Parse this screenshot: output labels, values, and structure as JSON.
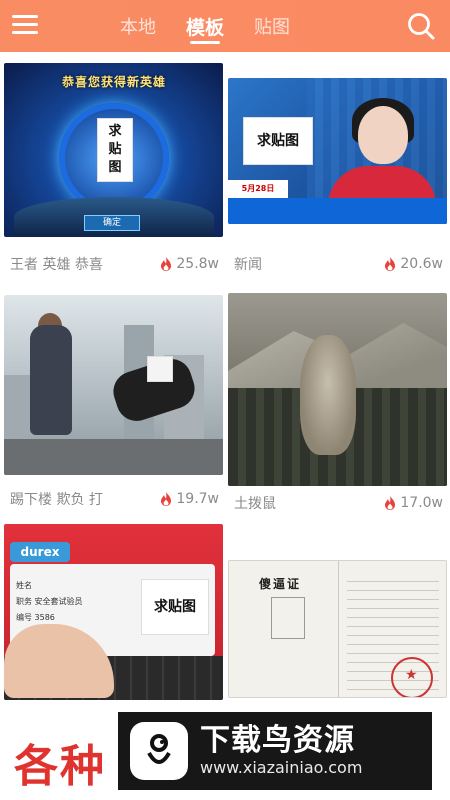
{
  "header": {
    "tabs": [
      {
        "label": "本地",
        "active": false
      },
      {
        "label": "模板",
        "active": true
      },
      {
        "label": "贴图",
        "active": false
      }
    ],
    "background": "#fa8a61"
  },
  "grid": {
    "items": [
      {
        "title": "王者 英雄 恭喜",
        "hot": "25.8w",
        "banner": "恭喜您获得新英雄",
        "placeholder": "求\n贴\n图",
        "button": "确定"
      },
      {
        "title": "新闻",
        "hot": "20.6w",
        "placeholder": "求贴图",
        "ticker": "5月28日"
      },
      {
        "title": "踢下楼 欺负 打",
        "hot": "19.7w",
        "placeholder": ""
      },
      {
        "title": "土拨鼠",
        "hot": "17.0w"
      },
      {
        "title": "",
        "hot": "",
        "brand": "durex",
        "placeholder": "求贴图",
        "rows": [
          "姓名",
          "职务  安全套试验员",
          "编号  3586"
        ]
      },
      {
        "title": "",
        "hot": "",
        "cert_title": "傻逼证"
      }
    ]
  },
  "bottom": {
    "title": "各种"
  },
  "watermark": {
    "title": "下载鸟资源",
    "url": "www.xiazainiao.com"
  },
  "colors": {
    "accent": "#fa8a61",
    "hot_flame": "#e8423a",
    "title_red": "#e0322e"
  }
}
